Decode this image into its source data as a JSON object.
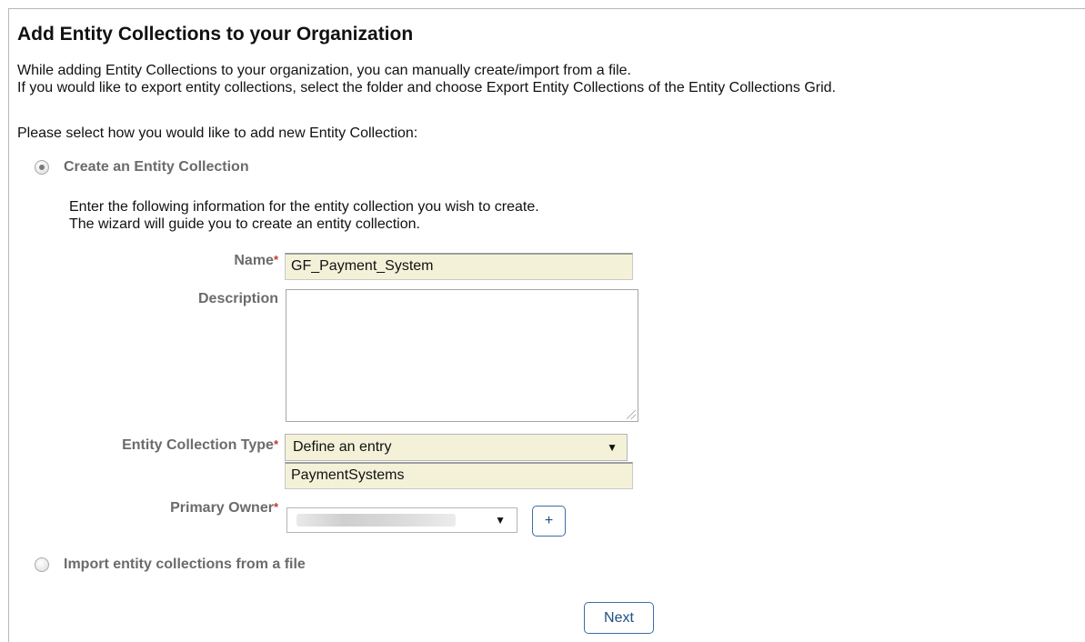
{
  "page": {
    "title": "Add Entity Collections to your Organization",
    "intro_line1": "While adding Entity Collections to your organization, you can manually create/import from a file.",
    "intro_line2": "If you would like to export entity collections, select the folder and choose Export Entity Collections of the Entity Collections Grid.",
    "prompt": "Please select how you would like to add new Entity Collection:"
  },
  "create_option": {
    "label": "Create an Entity Collection",
    "selected": true,
    "desc_line1": "Enter the following information for the entity collection you wish to create.",
    "desc_line2": "The wizard will guide you to create an entity collection."
  },
  "form": {
    "name_label": "Name",
    "name_value": "GF_Payment_System",
    "description_label": "Description",
    "description_value": "",
    "type_label": "Entity Collection Type",
    "type_selected": "Define an entry",
    "type_entry_value": "PaymentSystems",
    "owner_label": "Primary Owner",
    "required_marker": "*",
    "add_owner_label": "+"
  },
  "import_option": {
    "label": "Import entity collections from a file",
    "selected": false
  },
  "actions": {
    "next_label": "Next"
  },
  "icons": {
    "dropdown": "triangle-down-icon"
  },
  "colors": {
    "accent": "#3a6ea5",
    "required": "#c0392b",
    "field_bg": "#f4f1d9",
    "label": "#6b6b6b"
  }
}
